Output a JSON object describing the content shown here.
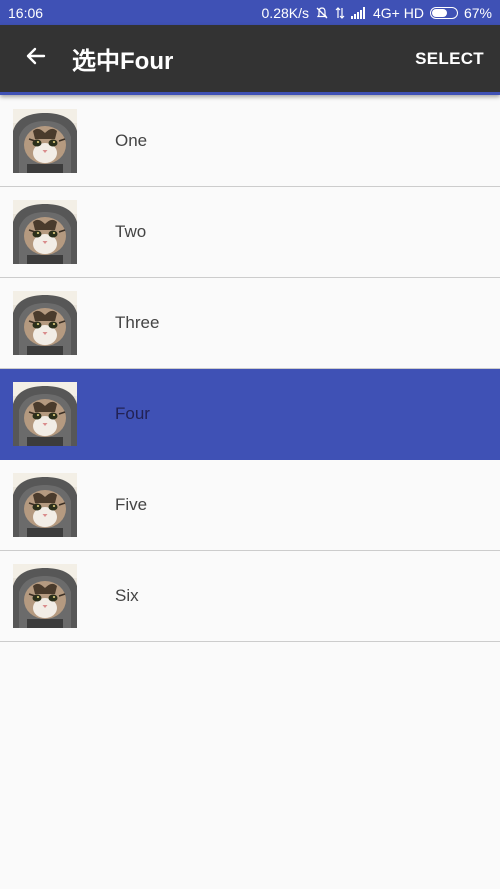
{
  "status_bar": {
    "time": "16:06",
    "network_speed": "0.28K/s",
    "network_type": "4G+ HD",
    "battery": "67%",
    "battery_level": 0.67,
    "icons": [
      "mute-icon",
      "data-arrows-icon",
      "signal-icon",
      "battery-icon"
    ]
  },
  "toolbar": {
    "back_icon": "arrow-left-icon",
    "title": "选中Four",
    "action_label": "SELECT"
  },
  "list": {
    "items": [
      {
        "label": "One",
        "selected": false,
        "image": "cat-thumbnail"
      },
      {
        "label": "Two",
        "selected": false,
        "image": "cat-thumbnail"
      },
      {
        "label": "Three",
        "selected": false,
        "image": "cat-thumbnail"
      },
      {
        "label": "Four",
        "selected": true,
        "image": "cat-thumbnail"
      },
      {
        "label": "Five",
        "selected": false,
        "image": "cat-thumbnail"
      },
      {
        "label": "Six",
        "selected": false,
        "image": "cat-thumbnail"
      }
    ]
  },
  "colors": {
    "primary": "#3f51b5",
    "toolbar": "#333333",
    "background": "#fafafa",
    "divider": "#cccccc"
  }
}
